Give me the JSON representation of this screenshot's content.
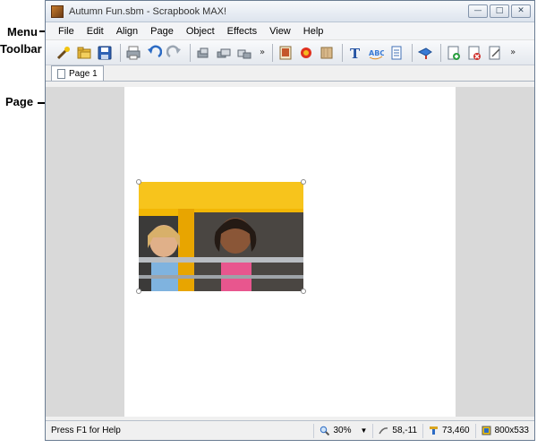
{
  "annotations": {
    "menu": "Menu",
    "toolbar": "Toolbar",
    "page": "Page"
  },
  "window": {
    "title": "Autumn Fun.sbm - Scrapbook MAX!",
    "controls": [
      "0",
      "1",
      "r"
    ]
  },
  "menu": {
    "items": [
      "File",
      "Edit",
      "Align",
      "Page",
      "Object",
      "Effects",
      "View",
      "Help"
    ]
  },
  "toolbar": {
    "more_glyph": "»",
    "buttons": [
      {
        "icon": "new-wand-icon"
      },
      {
        "icon": "open-folder-icon"
      },
      {
        "icon": "save-disk-icon"
      },
      {
        "icon": "print-icon"
      },
      {
        "icon": "undo-icon"
      },
      {
        "icon": "redo-icon"
      },
      {
        "icon": "bring-forward-icon"
      },
      {
        "icon": "send-backward-icon"
      },
      {
        "icon": "group-icon"
      },
      {
        "icon": "picture-icon"
      },
      {
        "icon": "embellishment-icon"
      },
      {
        "icon": "paper-icon"
      },
      {
        "icon": "text-icon"
      },
      {
        "icon": "word-art-icon"
      },
      {
        "icon": "journal-icon"
      },
      {
        "icon": "shape-icon"
      },
      {
        "icon": "add-page-icon"
      },
      {
        "icon": "delete-page-icon"
      },
      {
        "icon": "page-properties-icon"
      }
    ]
  },
  "tabs": [
    {
      "label": "Page 1",
      "active": true
    }
  ],
  "status": {
    "help": "Press F1 for Help",
    "zoom": "30%",
    "cursor": "58,-11",
    "position": "73,460",
    "size": "800x533"
  },
  "colors": {
    "workspace": "#d9d9d9",
    "page": "#ffffff",
    "bus_yellow": "#f2b705"
  }
}
